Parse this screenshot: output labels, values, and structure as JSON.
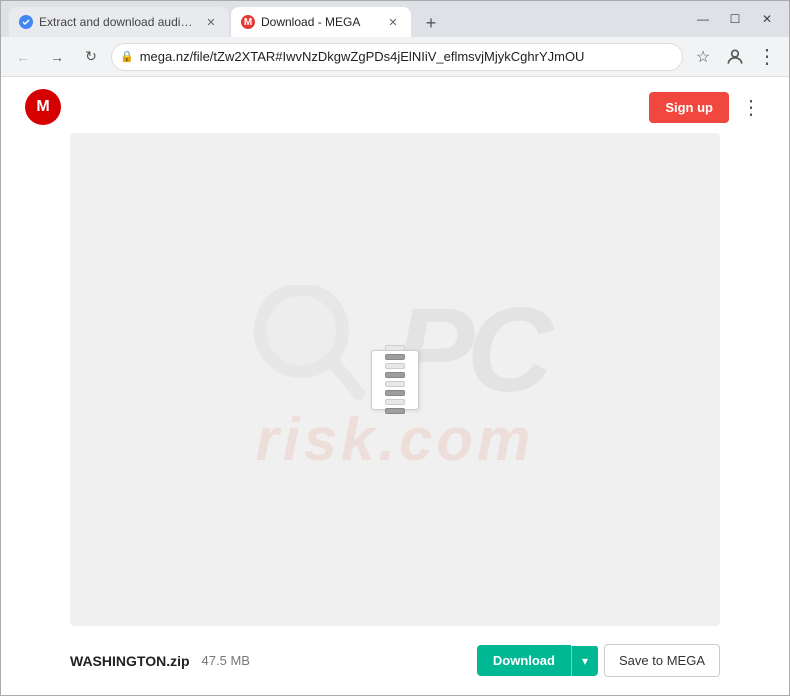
{
  "window": {
    "tabs": [
      {
        "id": "tab1",
        "title": "Extract and download audio an...",
        "favicon_type": "blue",
        "favicon_letter": "✓",
        "active": false
      },
      {
        "id": "tab2",
        "title": "Download - MEGA",
        "favicon_type": "red",
        "favicon_letter": "M",
        "active": true
      }
    ],
    "new_tab_label": "+",
    "minimize_icon": "—",
    "restore_icon": "☐",
    "close_icon": "✕"
  },
  "nav": {
    "back_label": "←",
    "forward_label": "→",
    "reload_label": "↻",
    "url": "mega.nz/file/tZw2XTAR#IwvNzDkgwZgPDs4jElNIiV_eflmsvjMjykCghrYJmOU",
    "star_icon": "☆",
    "profile_icon": "👤",
    "menu_icon": "⋮"
  },
  "page": {
    "logo_letter": "M",
    "signup_label": "Sign up",
    "dots_menu": "⋮",
    "watermark": {
      "pc_text": "PC",
      "risk_text": "risk.com"
    },
    "file": {
      "name": "WASHINGTON.zip",
      "size": "47.5 MB"
    },
    "actions": {
      "download_label": "Download",
      "dropdown_icon": "▾",
      "save_to_mega_label": "Save to MEGA"
    }
  }
}
